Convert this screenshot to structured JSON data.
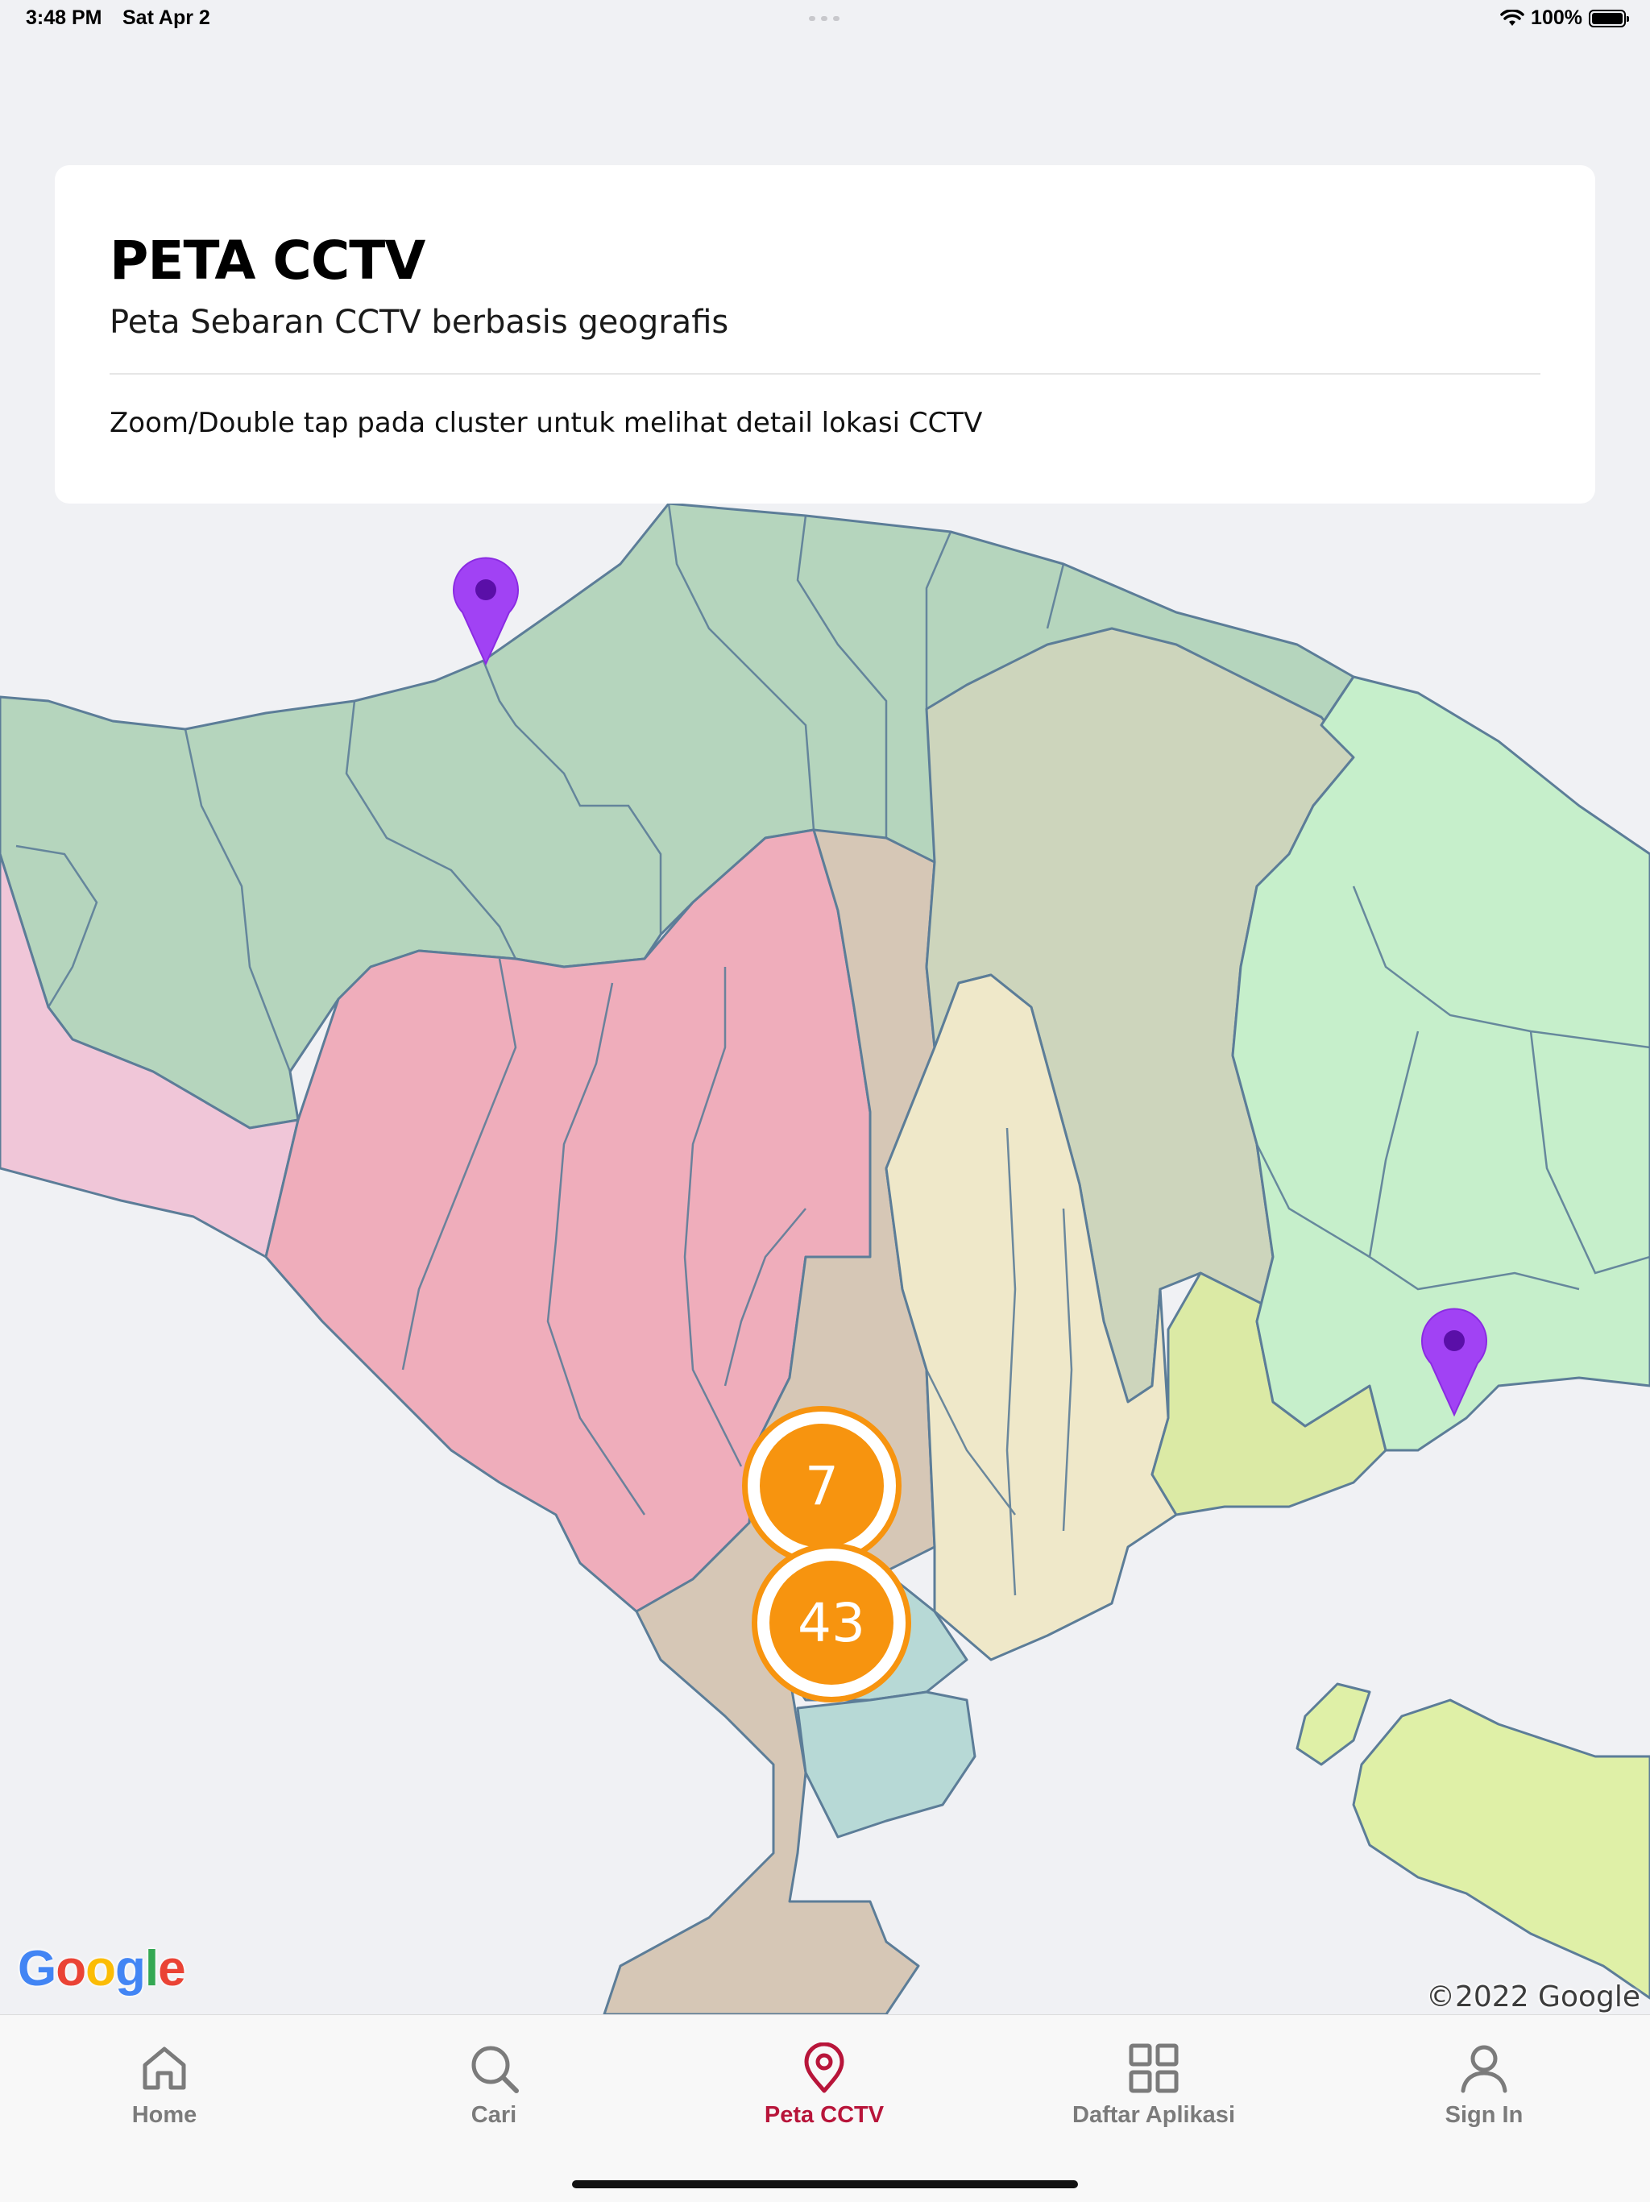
{
  "status_bar": {
    "time": "3:48 PM",
    "date": "Sat Apr 2",
    "battery": "100%",
    "icons": [
      "wifi-icon",
      "battery-icon"
    ]
  },
  "card": {
    "title": "PETA CCTV",
    "subtitle": "Peta Sebaran CCTV berbasis geografis",
    "hint": "Zoom/Double tap pada cluster untuk melihat detail lokasi CCTV"
  },
  "map": {
    "clusters": [
      {
        "count": "7"
      },
      {
        "count": "43"
      }
    ],
    "markers": [
      "location-pin-icon",
      "location-pin-icon"
    ],
    "attribution_logo": "Google",
    "copyright": "©2022 Google",
    "colors": {
      "cluster": "#f7940f",
      "marker": "#a142f4"
    }
  },
  "tabs": [
    {
      "label": "Home",
      "icon": "home-icon"
    },
    {
      "label": "Cari",
      "icon": "search-icon"
    },
    {
      "label": "Peta CCTV",
      "icon": "map-pin-icon",
      "active": true
    },
    {
      "label": "Daftar Aplikasi",
      "icon": "grid-icon"
    },
    {
      "label": "Sign In",
      "icon": "user-icon"
    }
  ],
  "colors": {
    "active_tab": "#b8153a",
    "inactive_tab": "#7b7b7b"
  }
}
